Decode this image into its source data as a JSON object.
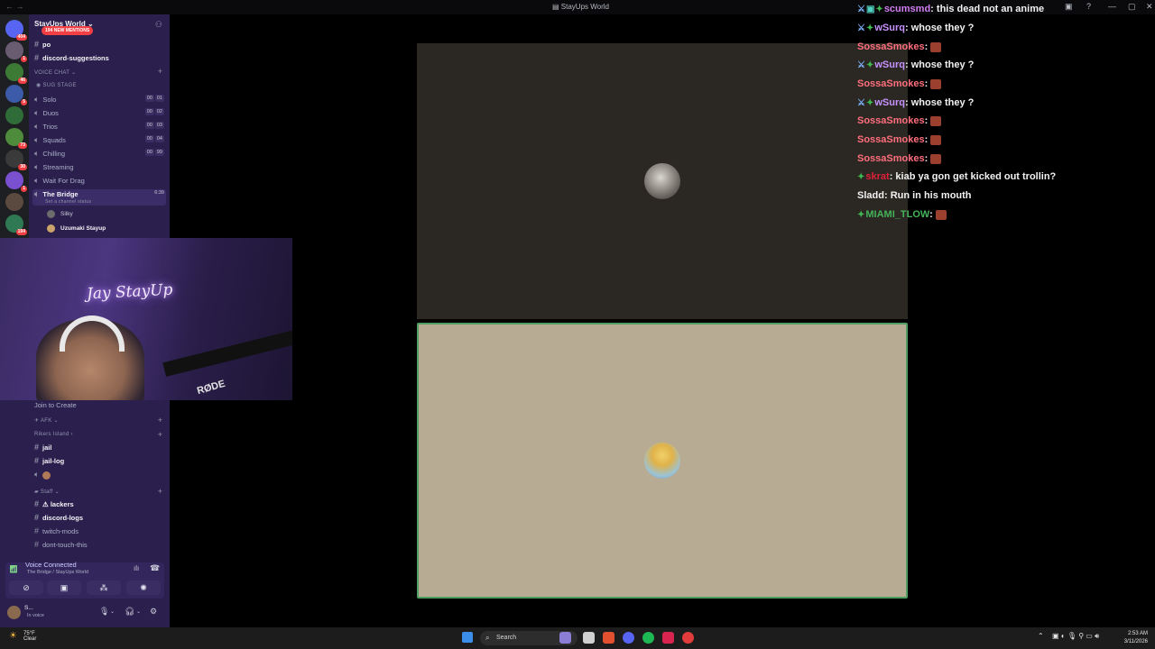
{
  "window": {
    "title": "StayUps World"
  },
  "server": {
    "name": "StayUps World",
    "mention_badge": "194 NEW MENTIONS"
  },
  "rail_badges": [
    "404",
    "1",
    "46",
    "5",
    "73",
    "30",
    "1",
    "194"
  ],
  "channels": {
    "top": [
      {
        "label": "po",
        "bold": true
      },
      {
        "label": "discord-suggestions",
        "bold": true
      }
    ],
    "voice_category": "VOICE CHAT",
    "stage": "SUG STAGE",
    "voice": [
      {
        "label": "Solo",
        "a": "00",
        "b": "01"
      },
      {
        "label": "Duos",
        "a": "00",
        "b": "02"
      },
      {
        "label": "Trios",
        "a": "00",
        "b": "03"
      },
      {
        "label": "Squads",
        "a": "00",
        "b": "04"
      },
      {
        "label": "Chilling",
        "a": "00",
        "b": "99"
      },
      {
        "label": "Streaming"
      },
      {
        "label": "Wait For Drag"
      }
    ],
    "active": {
      "label": "The Bridge",
      "time": "6:39",
      "status": "Set a channel status"
    },
    "members": [
      "Silky",
      "Uzumaki Stayup"
    ],
    "lower": {
      "join": "Join to Create",
      "afk": "AFK",
      "rikers": "Rikers Island",
      "jail": "jail",
      "jail_log": "jail-log",
      "staff": "Staff",
      "lackers": "lackers",
      "discord_logs": "discord-logs",
      "twitch_mods": "twitch-mods",
      "dont_touch": "dont-touch-this"
    }
  },
  "webcam": {
    "neon_sign": "Jay StayUp",
    "mic_brand": "RØDE"
  },
  "voice_panel": {
    "title": "Voice Connected",
    "subtitle": "The Bridge / StayUps World"
  },
  "user": {
    "name": "S...",
    "status": "In voice"
  },
  "chat": [
    {
      "user": "scumsmd",
      "color": "#d07cf0",
      "text": "this dead not an anime",
      "emote": false
    },
    {
      "user": "wSurq",
      "color": "#c792ff",
      "text": "whose they ?",
      "emote": false
    },
    {
      "user": "SossaSmokes",
      "color": "#ff6f7d",
      "text": "",
      "emote": true
    },
    {
      "user": "wSurq",
      "color": "#c792ff",
      "text": "whose they ?",
      "emote": false
    },
    {
      "user": "SossaSmokes",
      "color": "#ff6f7d",
      "text": "",
      "emote": true
    },
    {
      "user": "wSurq",
      "color": "#c792ff",
      "text": "whose they ?",
      "emote": false
    },
    {
      "user": "SossaSmokes",
      "color": "#ff6f7d",
      "text": "",
      "emote": true
    },
    {
      "user": "SossaSmokes",
      "color": "#ff6f7d",
      "text": "",
      "emote": true
    },
    {
      "user": "SossaSmokes",
      "color": "#ff6f7d",
      "text": "",
      "emote": true
    },
    {
      "user": "skrat",
      "color": "#e0203a",
      "text": "kiab ya gon get kicked out trollin?",
      "emote": false
    },
    {
      "user": "Sladd",
      "color": "#f1f1f1",
      "text": "Run in his mouth",
      "emote": false
    },
    {
      "user": "MIAMI_TLOW",
      "color": "#44b35a",
      "text": "",
      "emote": true
    }
  ],
  "taskbar": {
    "temp": "75°F",
    "weather": "Clear",
    "search": "Search",
    "time": "2:53 AM",
    "date": "3/11/2026"
  }
}
